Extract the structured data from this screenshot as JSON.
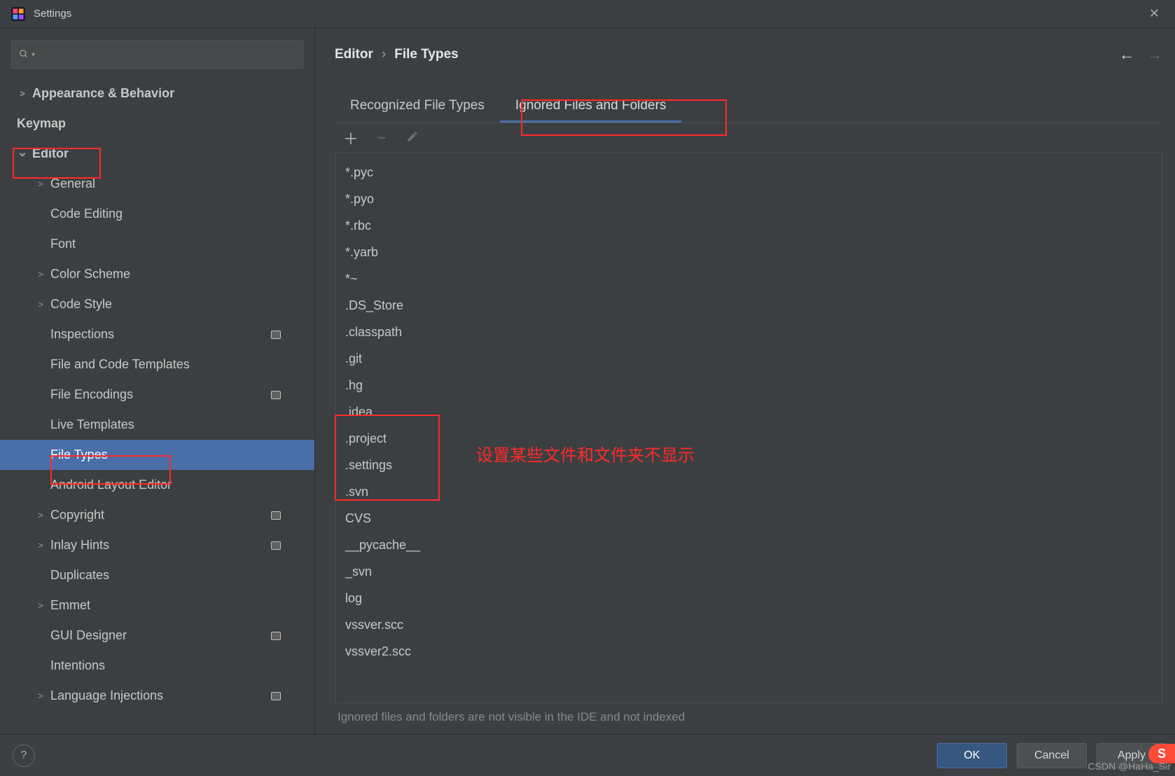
{
  "window": {
    "title": "Settings"
  },
  "breadcrumb": {
    "level1": "Editor",
    "level2": "File Types"
  },
  "tabs": {
    "recognized": "Recognized File Types",
    "ignored": "Ignored Files and Folders",
    "activeIndex": 1
  },
  "sidebar": {
    "items": [
      {
        "label": "Appearance & Behavior",
        "depth": 0,
        "expandable": true,
        "expanded": false,
        "bold": true
      },
      {
        "label": "Keymap",
        "depth": 0,
        "expandable": false,
        "bold": true
      },
      {
        "label": "Editor",
        "depth": 0,
        "expandable": true,
        "expanded": true,
        "bold": true,
        "highlight": true
      },
      {
        "label": "General",
        "depth": 1,
        "expandable": true,
        "expanded": false
      },
      {
        "label": "Code Editing",
        "depth": 1,
        "expandable": false
      },
      {
        "label": "Font",
        "depth": 1,
        "expandable": false
      },
      {
        "label": "Color Scheme",
        "depth": 1,
        "expandable": true,
        "expanded": false
      },
      {
        "label": "Code Style",
        "depth": 1,
        "expandable": true,
        "expanded": false
      },
      {
        "label": "Inspections",
        "depth": 1,
        "expandable": false,
        "badge": true
      },
      {
        "label": "File and Code Templates",
        "depth": 1,
        "expandable": false
      },
      {
        "label": "File Encodings",
        "depth": 1,
        "expandable": false,
        "badge": true
      },
      {
        "label": "Live Templates",
        "depth": 1,
        "expandable": false
      },
      {
        "label": "File Types",
        "depth": 1,
        "expandable": false,
        "selected": true
      },
      {
        "label": "Android Layout Editor",
        "depth": 1,
        "expandable": false
      },
      {
        "label": "Copyright",
        "depth": 1,
        "expandable": true,
        "expanded": false,
        "badge": true
      },
      {
        "label": "Inlay Hints",
        "depth": 1,
        "expandable": true,
        "expanded": false,
        "badge": true
      },
      {
        "label": "Duplicates",
        "depth": 1,
        "expandable": false
      },
      {
        "label": "Emmet",
        "depth": 1,
        "expandable": true,
        "expanded": false
      },
      {
        "label": "GUI Designer",
        "depth": 1,
        "expandable": false,
        "badge": true
      },
      {
        "label": "Intentions",
        "depth": 1,
        "expandable": false
      },
      {
        "label": "Language Injections",
        "depth": 1,
        "expandable": true,
        "expanded": false,
        "badge": true
      }
    ]
  },
  "ignored_patterns": [
    "*.pyc",
    "*.pyo",
    "*.rbc",
    "*.yarb",
    "*~",
    ".DS_Store",
    ".classpath",
    ".git",
    ".hg",
    ".idea",
    ".project",
    ".settings",
    ".svn",
    "CVS",
    "__pycache__",
    "_svn",
    "log",
    "vssver.scc",
    "vssver2.scc"
  ],
  "hint": "Ignored files and folders are not visible in the IDE and not indexed",
  "buttons": {
    "ok": "OK",
    "cancel": "Cancel",
    "apply": "Apply"
  },
  "annotations": {
    "red_text": "设置某些文件和文件夹不显示"
  },
  "watermark": "CSDN @HaHa_Sir"
}
